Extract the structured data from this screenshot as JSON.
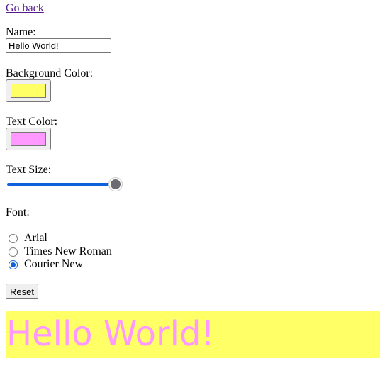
{
  "nav": {
    "back_link": "Go back"
  },
  "form": {
    "name_label": "Name:",
    "name_value": "Hello World!",
    "background_color_label": "Background Color:",
    "background_color": "#ffff66",
    "text_color_label": "Text Color:",
    "text_color": "#ff99ff",
    "text_size_label": "Text Size:",
    "text_size_level": 1.0,
    "font_label": "Font:",
    "font_options": [
      {
        "label": "Arial",
        "checked": false
      },
      {
        "label": "Times New Roman",
        "checked": false
      },
      {
        "label": "Courier New",
        "checked": true
      }
    ],
    "reset_label": "Reset"
  },
  "preview": {
    "text": "Hello World!"
  },
  "colors": {
    "link": "#551a8b",
    "accent": "#0f62d9"
  }
}
